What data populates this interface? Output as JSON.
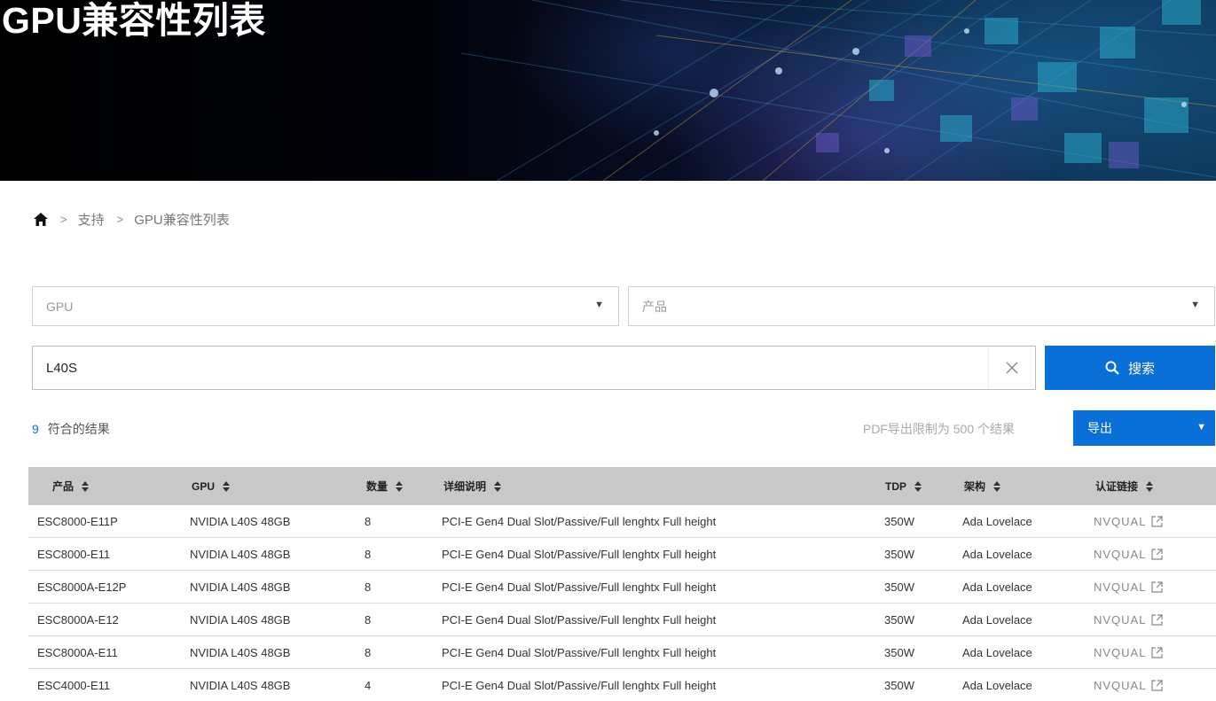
{
  "hero": {
    "title": "GPU兼容性列表"
  },
  "breadcrumb": {
    "level1": "支持",
    "level2": "GPU兼容性列表"
  },
  "filters": {
    "gpu_placeholder": "GPU",
    "product_placeholder": "产品"
  },
  "search": {
    "value": "L40S",
    "button_label": "搜索"
  },
  "results": {
    "count": "9",
    "label": "符合的结果",
    "pdf_note": "PDF导出限制为 500 个结果",
    "export_label": "导出"
  },
  "table": {
    "headers": {
      "product": "产品",
      "gpu": "GPU",
      "qty": "数量",
      "detail": "详细说明",
      "tdp": "TDP",
      "arch": "架构",
      "cert": "认证链接"
    },
    "rows": [
      {
        "product": "ESC8000-E11P",
        "gpu": "NVIDIA L40S 48GB",
        "qty": "8",
        "detail": "PCI-E Gen4 Dual Slot/Passive/Full lenghtx Full height",
        "tdp": "350W",
        "arch": "Ada Lovelace",
        "cert": "NVQUAL"
      },
      {
        "product": "ESC8000-E11",
        "gpu": "NVIDIA L40S 48GB",
        "qty": "8",
        "detail": "PCI-E Gen4 Dual Slot/Passive/Full lenghtx Full height",
        "tdp": "350W",
        "arch": "Ada Lovelace",
        "cert": "NVQUAL"
      },
      {
        "product": "ESC8000A-E12P",
        "gpu": "NVIDIA L40S 48GB",
        "qty": "8",
        "detail": "PCI-E Gen4 Dual Slot/Passive/Full lenghtx Full height",
        "tdp": "350W",
        "arch": "Ada Lovelace",
        "cert": "NVQUAL"
      },
      {
        "product": "ESC8000A-E12",
        "gpu": "NVIDIA L40S 48GB",
        "qty": "8",
        "detail": "PCI-E Gen4 Dual Slot/Passive/Full lenghtx Full height",
        "tdp": "350W",
        "arch": "Ada Lovelace",
        "cert": "NVQUAL"
      },
      {
        "product": "ESC8000A-E11",
        "gpu": "NVIDIA L40S 48GB",
        "qty": "8",
        "detail": "PCI-E Gen4 Dual Slot/Passive/Full lenghtx Full height",
        "tdp": "350W",
        "arch": "Ada Lovelace",
        "cert": "NVQUAL"
      },
      {
        "product": "ESC4000-E11",
        "gpu": "NVIDIA L40S 48GB",
        "qty": "4",
        "detail": "PCI-E Gen4 Dual Slot/Passive/Full lenghtx Full height",
        "tdp": "350W",
        "arch": "Ada Lovelace",
        "cert": "NVQUAL"
      }
    ]
  },
  "colors": {
    "accent": "#0a6fd6",
    "header_bg": "#c9c9c9"
  },
  "icons": {
    "home": "home-icon",
    "clear": "close-icon",
    "search": "search-icon",
    "external": "external-link-icon"
  }
}
